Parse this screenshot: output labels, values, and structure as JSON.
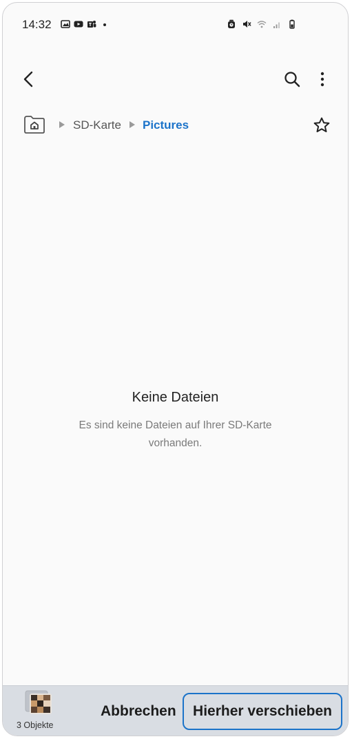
{
  "status_bar": {
    "time": "14:32",
    "left_icons": [
      "gallery-icon",
      "youtube-icon",
      "teams-icon",
      "dot-icon"
    ],
    "right_icons": [
      "alarm-icon",
      "mute-icon",
      "wifi-icon",
      "signal-icon",
      "battery-icon"
    ]
  },
  "app_bar": {
    "back_icon": "back-arrow-icon",
    "search_icon": "search-icon",
    "more_icon": "more-vert-icon"
  },
  "breadcrumb": {
    "items": [
      "SD-Karte",
      "Pictures"
    ],
    "active_color": "#1b73c9"
  },
  "empty_state": {
    "title": "Keine Dateien",
    "description": "Es sind keine Dateien auf Ihrer SD-Karte vorhanden."
  },
  "bottom_bar": {
    "count_label": "3 Objekte",
    "cancel_label": "Abbrechen",
    "move_label": "Hierher verschieben",
    "highlight_color": "#1b73c9"
  }
}
